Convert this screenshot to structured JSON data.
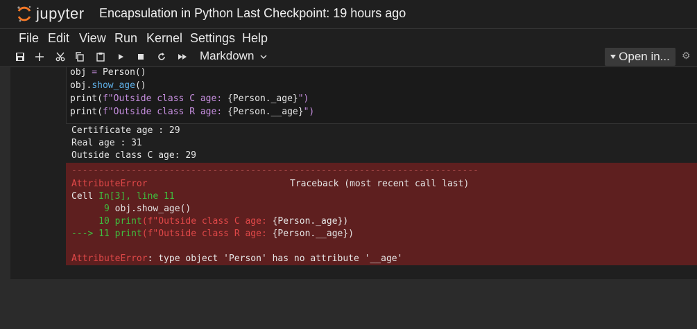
{
  "header": {
    "logo_text": "jupyter",
    "title": "Encapsulation in Python",
    "checkpoint": "Last Checkpoint: 19 hours ago"
  },
  "menu": [
    "File",
    "Edit",
    "View",
    "Run",
    "Kernel",
    "Settings",
    "Help"
  ],
  "toolbar": {
    "icons": [
      "save-icon",
      "plus-icon",
      "cut-icon",
      "copy-icon",
      "paste-icon",
      "run-icon",
      "stop-icon",
      "restart-icon",
      "fast-forward-icon"
    ],
    "cell_type": "Markdown",
    "open_label": "Open in...",
    "accent": "#1f1f1f"
  },
  "code": {
    "l1a": "obj",
    "l1b": " = ",
    "l1c": "Person()",
    "l2a": "obj.",
    "l2b": "show_age",
    "l2c": "()",
    "l3a": "print(",
    "l3b": "f\"Outside class C age: ",
    "l3c": "{Person._age}",
    "l3d": "\")",
    "l4a": "print(",
    "l4b": "f\"Outside class R age: ",
    "l4c": "{Person.__age}",
    "l4d": "\")"
  },
  "output": {
    "lines": [
      "Certificate age : 29",
      "Real age : 31",
      "Outside class C age: 29"
    ]
  },
  "error": {
    "separator": "---------------------------------------------------------------------------",
    "name": "AttributeError",
    "traceback": "Traceback (most recent call last)",
    "cell_label": "Cell ",
    "cell_ref": "In[3], line 11",
    "t9num": "      9 ",
    "t9code": "obj.show_age()",
    "t10num": "     10 ",
    "t10print": "print",
    "t10str": "(f\"Outside class C age: ",
    "t10expr": "{Person._age}",
    "t10end": ")",
    "t11arrow": "---> 11 ",
    "t11print": "print",
    "t11str": "(f\"Outside class R age: ",
    "t11expr": "{Person.__age}",
    "t11end": ")",
    "final_name": "AttributeError",
    "final_msg": ": type object 'Person' has no attribute '__age'",
    "bg": "#5e1f1f"
  }
}
